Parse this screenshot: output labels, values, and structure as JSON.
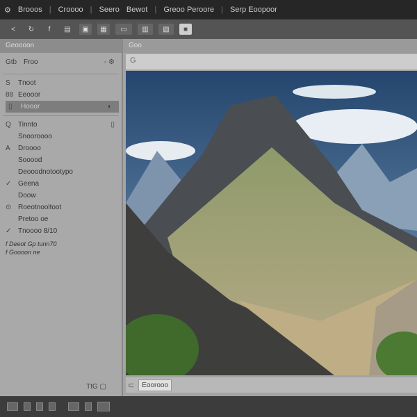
{
  "titlebar": {
    "menu": [
      "Brooos",
      "Croooo",
      "Seero",
      "Bewot",
      "Greoo Peroore",
      "Serp Eoopoor"
    ]
  },
  "toolbar": {
    "icons": [
      "back-icon",
      "rotate-icon",
      "text-icon",
      "frame-icon",
      "lock-icon",
      "grid-icon",
      "layers-icon",
      "crop-icon",
      "compare-icon",
      "preview-icon"
    ]
  },
  "left_panel": {
    "header": "Geoooon",
    "selector": {
      "icon": "Gtb",
      "label": "Froo"
    },
    "items": [
      {
        "icon": "S",
        "label": "Tnoot"
      },
      {
        "icon": "88",
        "label": "Eeooor"
      },
      {
        "label": "Hooor",
        "selected": true
      },
      {
        "icon": "Q",
        "label": "Tinnto"
      },
      {
        "label": "Snooroooo"
      },
      {
        "icon": "A",
        "label": "Droooo"
      },
      {
        "label": "Sooood"
      },
      {
        "label": "Deooodnotootypo"
      },
      {
        "icon": "✓",
        "label": "Geena"
      },
      {
        "label": "Doow"
      },
      {
        "icon": "⊙",
        "label": "Roeotnooltoot"
      },
      {
        "label": "Pretoo oe"
      },
      {
        "icon": "✓",
        "label": "Tnoooo 8/10"
      }
    ],
    "notes": [
      "f Deeot Gp tunn70",
      "f Goooon ne"
    ],
    "footer": "TtG"
  },
  "right_panel": {
    "header": "Goo",
    "tool_icon": "G",
    "bottom_button": "Eoorooo"
  }
}
